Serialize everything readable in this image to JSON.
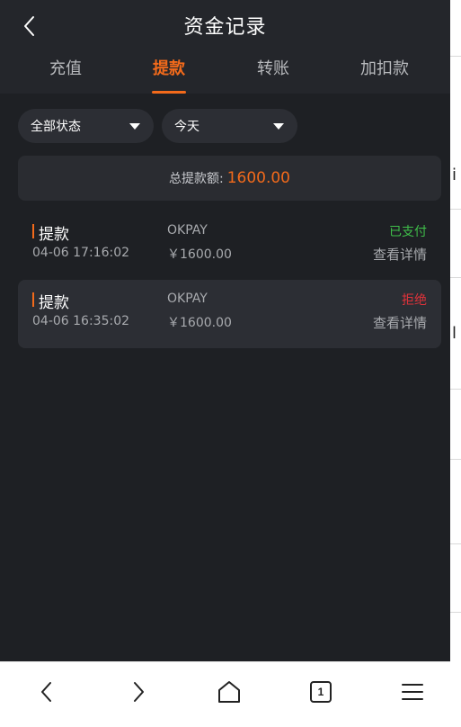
{
  "header": {
    "title": "资金记录"
  },
  "tabs": [
    {
      "label": "充值",
      "active": false
    },
    {
      "label": "提款",
      "active": true
    },
    {
      "label": "转账",
      "active": false
    },
    {
      "label": "加扣款",
      "active": false
    }
  ],
  "filters": {
    "status": "全部状态",
    "date": "今天"
  },
  "total": {
    "label": "总提款额:",
    "value": "1600.00"
  },
  "records": [
    {
      "type": "提款",
      "time": "04-06 17:16:02",
      "channel": "OKPAY",
      "amount": "￥1600.00",
      "status": "已支付",
      "status_color": "#3fbf4a",
      "detail_label": "查看详情"
    },
    {
      "type": "提款",
      "time": "04-06 16:35:02",
      "channel": "OKPAY",
      "amount": "￥1600.00",
      "status": "拒绝",
      "status_color": "#e0323a",
      "detail_label": "查看详情"
    }
  ],
  "browser_bar": {
    "tab_count": "1"
  },
  "colors": {
    "accent": "#f26a1b",
    "background": "#1e2024",
    "header": "#24262b"
  },
  "icons": [
    "back-chevron-icon",
    "caret-down-icon",
    "browser-back-icon",
    "browser-forward-icon",
    "home-icon",
    "tabs-icon",
    "menu-icon"
  ]
}
